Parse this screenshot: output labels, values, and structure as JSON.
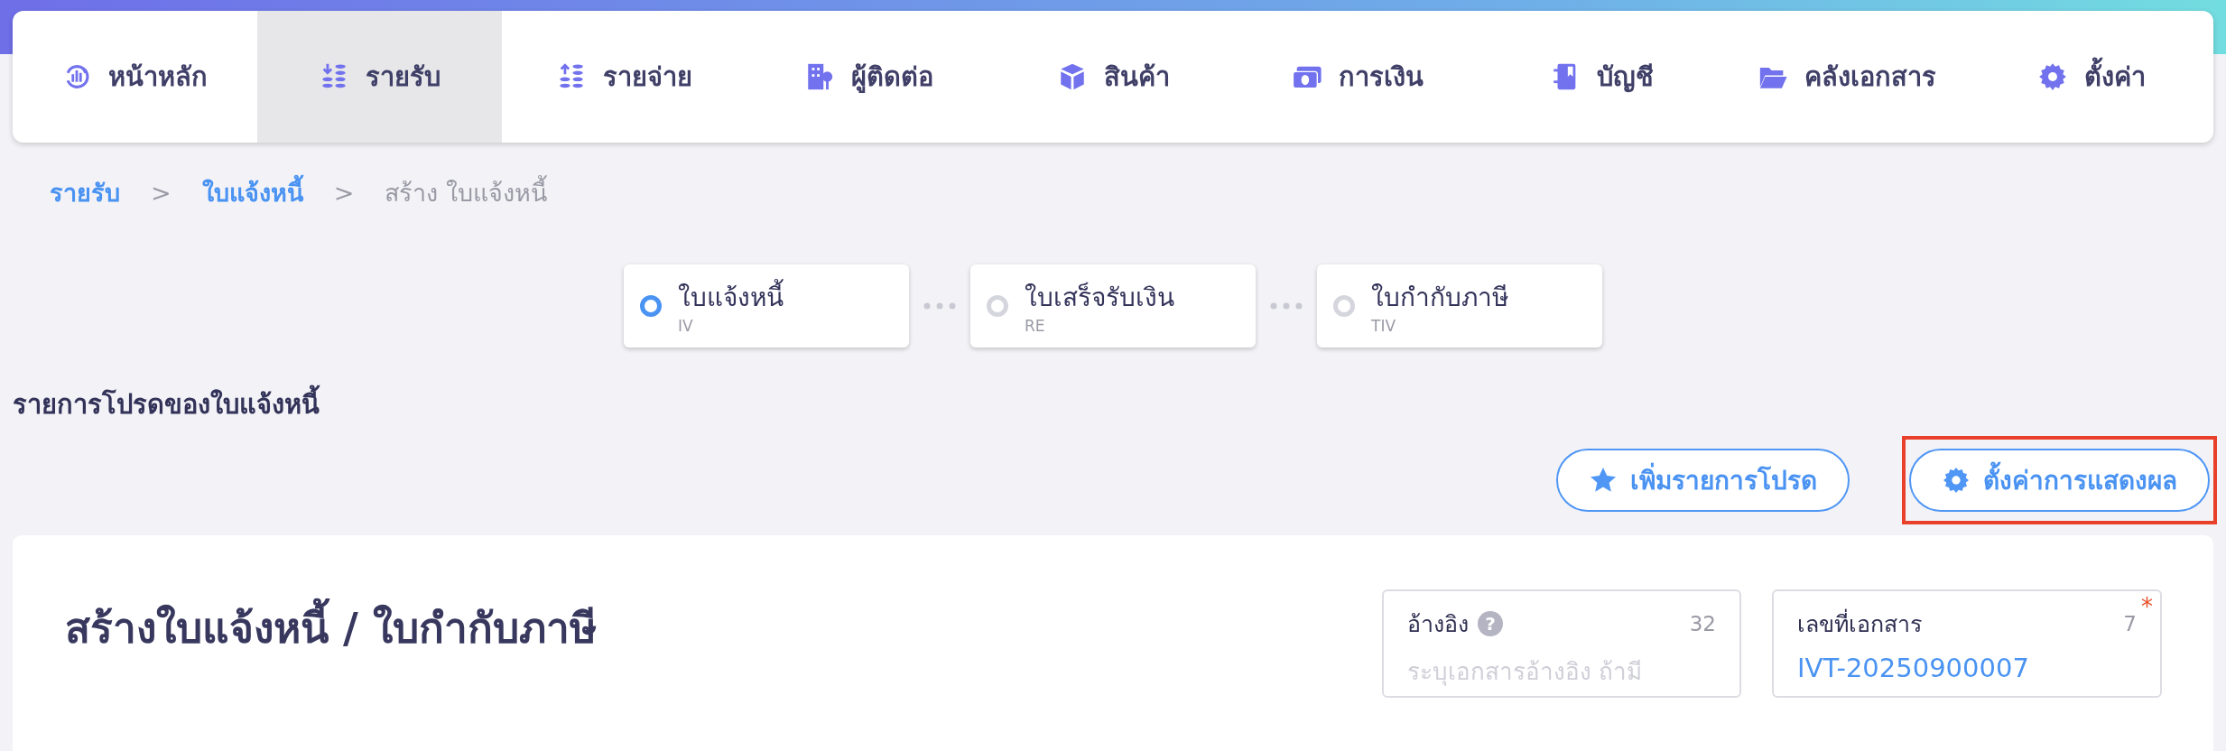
{
  "nav": [
    {
      "label": "หน้าหลัก",
      "kind": "dashboard",
      "selected": false
    },
    {
      "label": "รายรับ",
      "kind": "income",
      "selected": true
    },
    {
      "label": "รายจ่าย",
      "kind": "expense",
      "selected": false
    },
    {
      "label": "ผู้ติดต่อ",
      "kind": "contacts",
      "selected": false
    },
    {
      "label": "สินค้า",
      "kind": "products",
      "selected": false
    },
    {
      "label": "การเงิน",
      "kind": "finance",
      "selected": false
    },
    {
      "label": "บัญชี",
      "kind": "accounts",
      "selected": false
    },
    {
      "label": "คลังเอกสาร",
      "kind": "documents",
      "selected": false
    },
    {
      "label": "ตั้งค่า",
      "kind": "settings",
      "selected": false
    }
  ],
  "breadcrumb": [
    {
      "label": "รายรับ",
      "kind": "link"
    },
    {
      "label": "ใบแจ้งหนี้",
      "kind": "link"
    },
    {
      "label": "สร้าง ใบแจ้งหนี้",
      "kind": "current"
    }
  ],
  "breadcrumb_separator": ">",
  "steps": [
    {
      "title": "ใบแจ้งหนี้",
      "code": "IV",
      "selected": true
    },
    {
      "title": "ใบเสร็จรับเงิน",
      "code": "RE",
      "selected": false
    },
    {
      "title": "ใบกำกับภาษี",
      "code": "TIV",
      "selected": false
    }
  ],
  "favorites_title": "รายการโปรดของใบแจ้งหนี้",
  "buttons": [
    {
      "label": "เพิ่มรายการโปรด",
      "kind": "favorite",
      "highlighted": false
    },
    {
      "label": "ตั้งค่าการแสดงผล",
      "kind": "settings",
      "highlighted": true
    }
  ],
  "page_title": "สร้างใบแจ้งหนี้ / ใบกำกับภาษี",
  "fields": [
    {
      "label": "อ้างอิง",
      "help": "?",
      "count": "32",
      "placeholder": "ระบุเอกสารอ้างอิง ถ้ามี"
    },
    {
      "label": "เลขที่เอกสาร",
      "count": "7",
      "value": "IVT-20250900007",
      "required_mark": "*"
    }
  ]
}
